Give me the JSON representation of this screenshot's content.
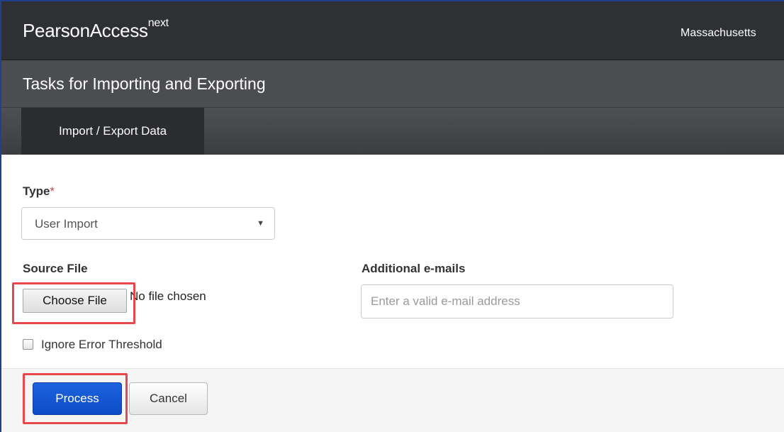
{
  "app": {
    "brand_name": "PearsonAccess",
    "brand_suffix": "next",
    "organization": "Massachusetts"
  },
  "tasks": {
    "title": "Tasks for Importing and Exporting"
  },
  "tabs": [
    {
      "label": "Import / Export Data",
      "active": true
    }
  ],
  "form": {
    "type_label": "Type",
    "required_marker": "*",
    "type_selected": "User Import",
    "source_file_label": "Source File",
    "choose_file_label": "Choose File",
    "file_status": "No file chosen",
    "additional_emails_label": "Additional e-mails",
    "email_placeholder": "Enter a valid e-mail address",
    "email_value": "",
    "ignore_error_threshold_label": "Ignore Error Threshold",
    "ignore_error_threshold_checked": false
  },
  "footer": {
    "process_label": "Process",
    "cancel_label": "Cancel"
  },
  "icons": {
    "select_caret": "chevron-down-icon"
  },
  "colors": {
    "header_bg": "#2e3033",
    "tasks_bar_bg": "#4b4d51",
    "primary_button": "#1e63de",
    "highlight_border": "#e8474c",
    "required_marker": "#b94a48"
  }
}
